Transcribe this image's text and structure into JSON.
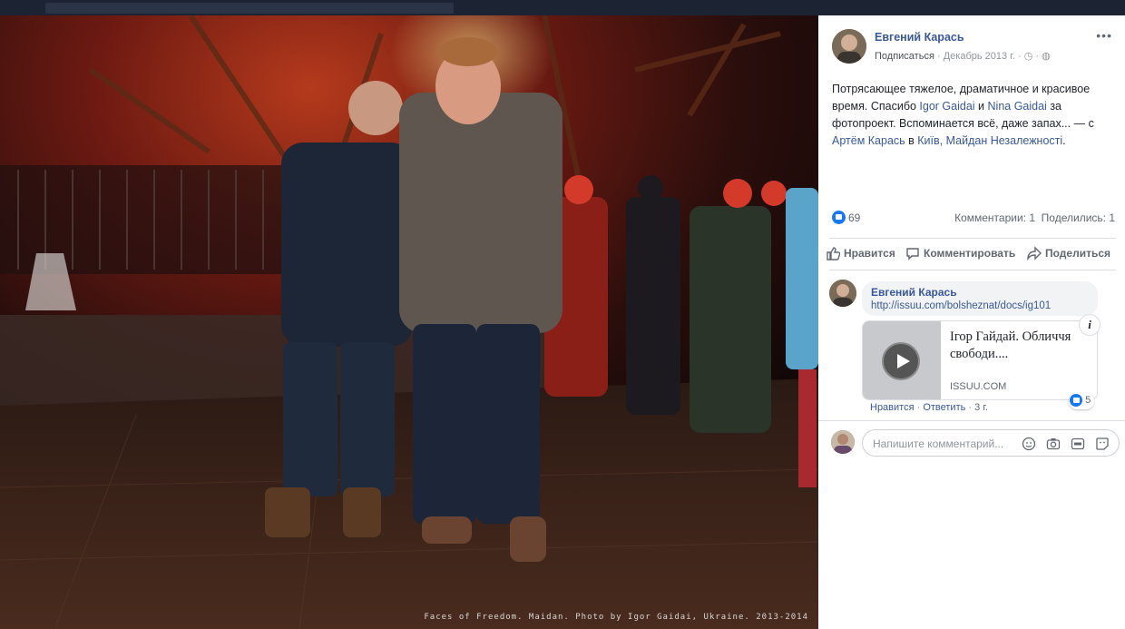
{
  "photo": {
    "caption": "Faces of Freedom. Maidan. Photo by Igor Gaidai, Ukraine. 2013-2014"
  },
  "post": {
    "author": "Евгений Карась",
    "follow": "Подписаться",
    "date": "Декабрь 2013 г.",
    "more": "•••",
    "text_1": "Потрясающее тяжелое, драматичное и красивое время. Спасибо ",
    "mention_1": "Igor Gaidai",
    "text_2": " и ",
    "mention_2": "Nina Gaidai",
    "text_3": " за фотопроект. Вспоминается всё, даже запах... — с ",
    "mention_3": "Артём Карась",
    "text_4": " в ",
    "place_1": "Київ, Майдан Незалежності",
    "text_5": "."
  },
  "stats": {
    "likes": "69",
    "comments": "Комментарии: 1",
    "shares": "Поделились: 1"
  },
  "actions": {
    "like": "Нравится",
    "comment": "Комментировать",
    "share": "Поделиться"
  },
  "comment": {
    "author": "Евгений Карась",
    "link": "http://issuu.com/bolsheznat/docs/ig101",
    "card_title": "Ігор Гайдай. Обличчя свободи....",
    "card_domain": "ISSUU.COM",
    "info": "i",
    "like": "Нравится",
    "reply": "Ответить",
    "time": "3 г.",
    "reactions": "5"
  },
  "composer": {
    "placeholder": "Напишите комментарий..."
  },
  "colors": {
    "link": "#385898",
    "like_blue": "#1877f2"
  }
}
